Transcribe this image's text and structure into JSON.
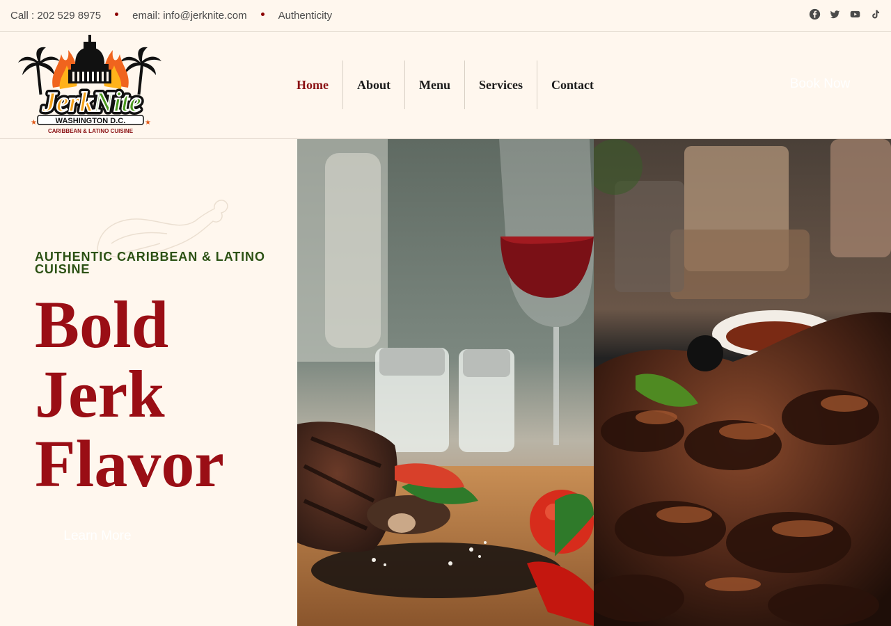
{
  "topbar": {
    "phone": "Call : 202 529 8975",
    "email": "email: info@jerknite.com",
    "tagline": "Authenticity",
    "social_icons": [
      "facebook-icon",
      "twitter-icon",
      "youtube-icon",
      "tiktok-icon"
    ]
  },
  "logo": {
    "brand": "JerkNite",
    "location": "WASHINGTON D.C.",
    "cuisine": "CARIBBEAN & LATINO CUISINE"
  },
  "nav": {
    "items": [
      {
        "label": "Home",
        "active": true
      },
      {
        "label": "About"
      },
      {
        "label": "Menu"
      },
      {
        "label": "Services"
      },
      {
        "label": "Contact"
      }
    ],
    "cta": "Book Now"
  },
  "hero": {
    "subtitle": "AUTHENTIC CARIBBEAN & LATINO CUISINE",
    "headline": [
      "Bold",
      "Jerk",
      "Flavor"
    ],
    "cta": "Learn More"
  },
  "colors": {
    "background": "#fff7ee",
    "accent_red": "#9a0e15",
    "accent_green": "#2c5114",
    "dot": "#8b0000"
  }
}
